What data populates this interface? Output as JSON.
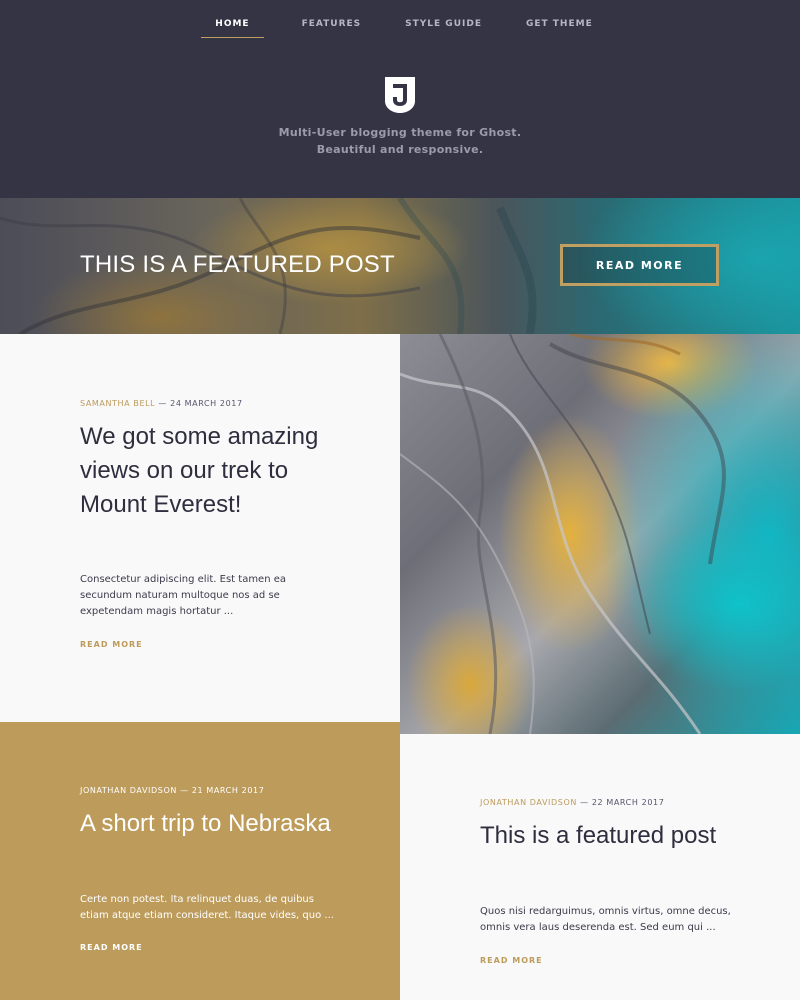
{
  "nav": {
    "items": [
      {
        "label": "HOME",
        "active": true
      },
      {
        "label": "FEATURES",
        "active": false
      },
      {
        "label": "STYLE GUIDE",
        "active": false
      },
      {
        "label": "GET THEME",
        "active": false
      }
    ]
  },
  "header": {
    "logo_icon": "j-shield-logo",
    "tagline_line1": "Multi-User blogging theme for Ghost.",
    "tagline_line2": "Beautiful and responsive."
  },
  "featured_banner": {
    "title": "THIS IS A FEATURED POST",
    "button_label": "READ MORE"
  },
  "posts": [
    {
      "author": "SAMANTHA BELL",
      "date": "24 MARCH 2017",
      "title": "We got some amazing views on our trek to Mount Everest!",
      "excerpt": "Consectetur adipiscing elit. Est tamen ea secundum naturam multoque nos ad se expetendam magis hortatur ...",
      "read_more": "READ MORE"
    },
    {
      "author": "JONATHAN DAVIDSON",
      "date": "21 MARCH 2017",
      "title": "A short trip to Nebraska",
      "excerpt": "Certe non potest. Ita relinquet duas, de quibus etiam atque etiam consideret. Itaque vides, quo ...",
      "read_more": "READ MORE"
    },
    {
      "author": "JONATHAN DAVIDSON",
      "date": "22 MARCH 2017",
      "title": "This is a featured post",
      "excerpt": "Quos nisi redarguimus, omnis virtus, omne decus, omnis vera laus deserenda est. Sed eum qui ...",
      "read_more": "READ MORE"
    }
  ],
  "meta_separator": " — ",
  "colors": {
    "header_bg": "#353444",
    "accent_gold": "#bd9b5b",
    "card_white": "#f9f9fa"
  }
}
